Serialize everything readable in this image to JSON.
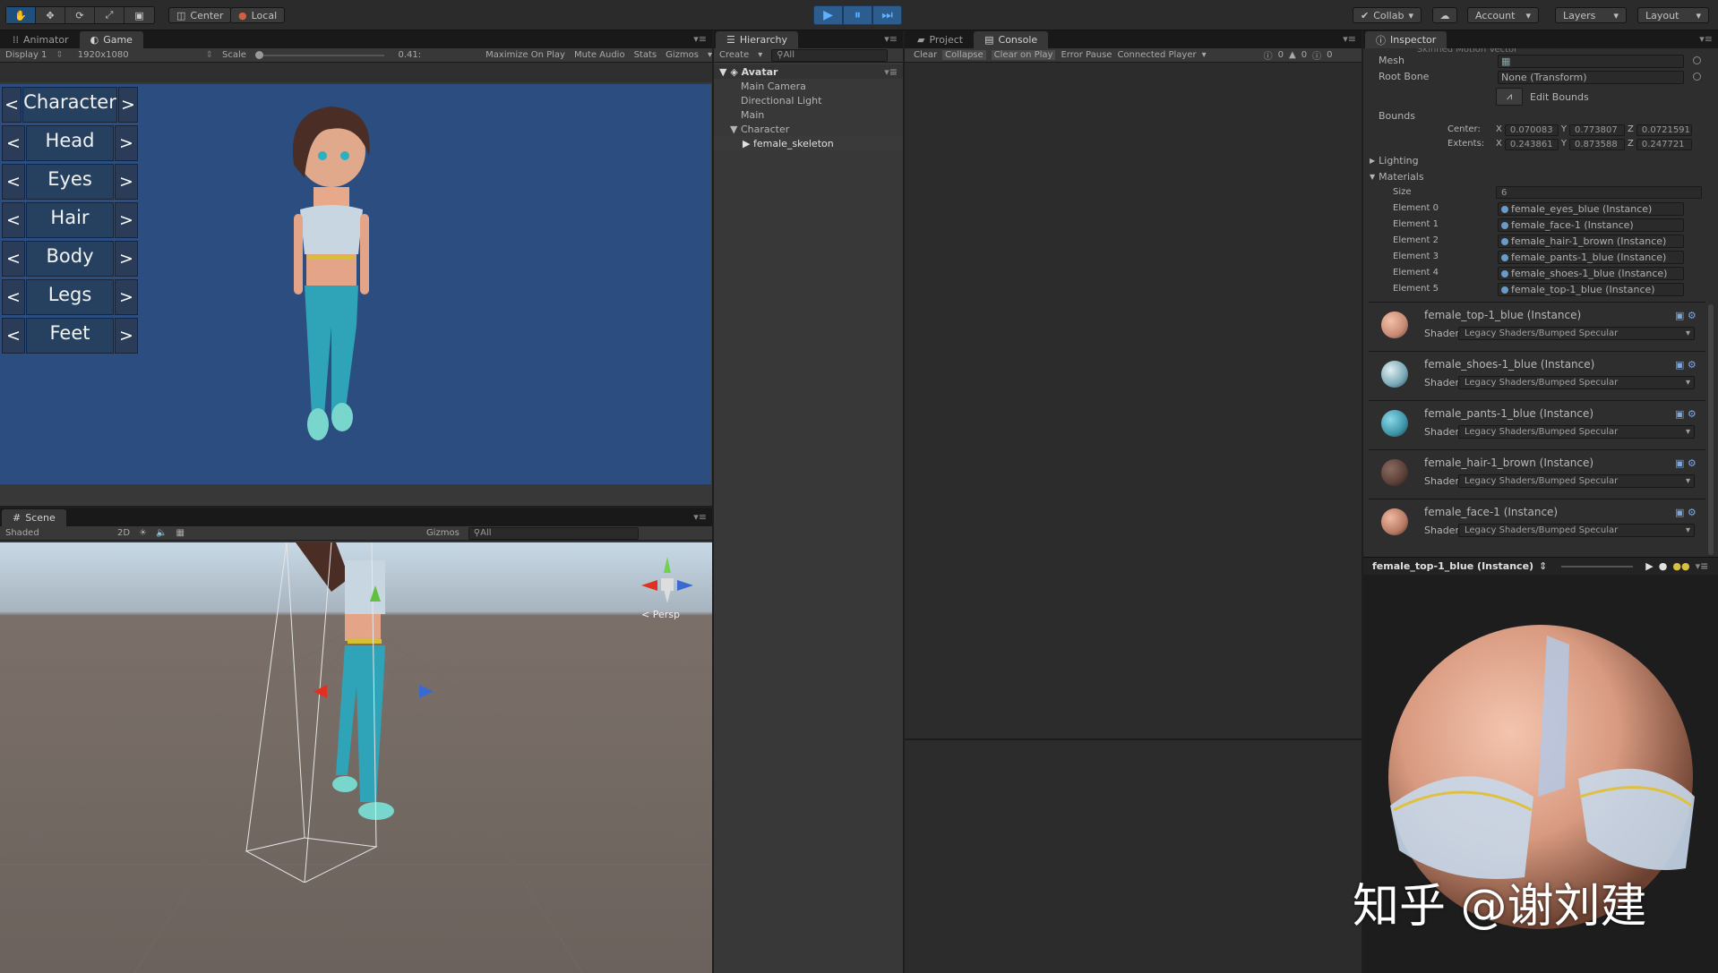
{
  "toolbar": {
    "pivot_mode": "Center",
    "pivot_rotation": "Local",
    "collab": "Collab",
    "account": "Account",
    "layers": "Layers",
    "layout": "Layout"
  },
  "game_panel": {
    "tabs": [
      "Animator",
      "Game"
    ],
    "display": "Display 1",
    "resolution": "1920x1080",
    "scale_label": "Scale",
    "scale_value": "0.41:",
    "options": [
      "Maximize On Play",
      "Mute Audio",
      "Stats",
      "Gizmos"
    ],
    "customizer": {
      "prev": "<",
      "next": ">",
      "categories": [
        "Character",
        "Head",
        "Eyes",
        "Hair",
        "Body",
        "Legs",
        "Feet"
      ]
    }
  },
  "scene_panel": {
    "tab": "Scene",
    "shading": "Shaded",
    "mode_2d": "2D",
    "gizmos": "Gizmos",
    "search_placeholder": "All",
    "persp": "Persp"
  },
  "hierarchy": {
    "tab": "Hierarchy",
    "create": "Create",
    "search_placeholder": "All",
    "scene_name": "Avatar",
    "items": [
      {
        "label": "Main Camera"
      },
      {
        "label": "Directional Light"
      },
      {
        "label": "Main"
      },
      {
        "label": "Character"
      },
      {
        "label": "female_skeleton"
      }
    ]
  },
  "console": {
    "tabs": [
      "Project",
      "Console"
    ],
    "buttons": [
      "Clear",
      "Collapse",
      "Clear on Play",
      "Error Pause",
      "Connected Player"
    ],
    "counts": [
      "0",
      "0",
      "0"
    ]
  },
  "inspector": {
    "tab": "Inspector",
    "top_cut": "Skinned Motion Vector",
    "mesh_label": "Mesh",
    "root_bone_label": "Root Bone",
    "root_bone_value": "None (Transform)",
    "edit_bounds": "Edit Bounds",
    "bounds_label": "Bounds",
    "center_label": "Center:",
    "center": {
      "x": "0.070083",
      "y": "0.773807",
      "z": "0.0721591"
    },
    "extents_label": "Extents:",
    "extents": {
      "x": "0.243861",
      "y": "0.873588",
      "z": "0.247721"
    },
    "lighting": "Lighting",
    "materials": "Materials",
    "size_label": "Size",
    "size_value": "6",
    "elements": [
      {
        "label": "Element 0",
        "value": "female_eyes_blue (Instance)"
      },
      {
        "label": "Element 1",
        "value": "female_face-1 (Instance)"
      },
      {
        "label": "Element 2",
        "value": "female_hair-1_brown (Instance)"
      },
      {
        "label": "Element 3",
        "value": "female_pants-1_blue (Instance)"
      },
      {
        "label": "Element 4",
        "value": "female_shoes-1_blue (Instance)"
      },
      {
        "label": "Element 5",
        "value": "female_top-1_blue (Instance)"
      }
    ],
    "shader_label": "Shader",
    "material_blocks": [
      {
        "name": "female_top-1_blue (Instance)",
        "shader": "Legacy Shaders/Bumped Specular",
        "color": "#c98a74"
      },
      {
        "name": "female_shoes-1_blue (Instance)",
        "shader": "Legacy Shaders/Bumped Specular",
        "color": "#7aa8b8"
      },
      {
        "name": "female_pants-1_blue (Instance)",
        "shader": "Legacy Shaders/Bumped Specular",
        "color": "#3e95a8"
      },
      {
        "name": "female_hair-1_brown (Instance)",
        "shader": "Legacy Shaders/Bumped Specular",
        "color": "#5a4038"
      },
      {
        "name": "female_face-1 (Instance)",
        "shader": "Legacy Shaders/Bumped Specular",
        "color": "#b87a64"
      }
    ],
    "preview_title": "female_top-1_blue (Instance)"
  },
  "watermark": "知乎 @谢刘建"
}
